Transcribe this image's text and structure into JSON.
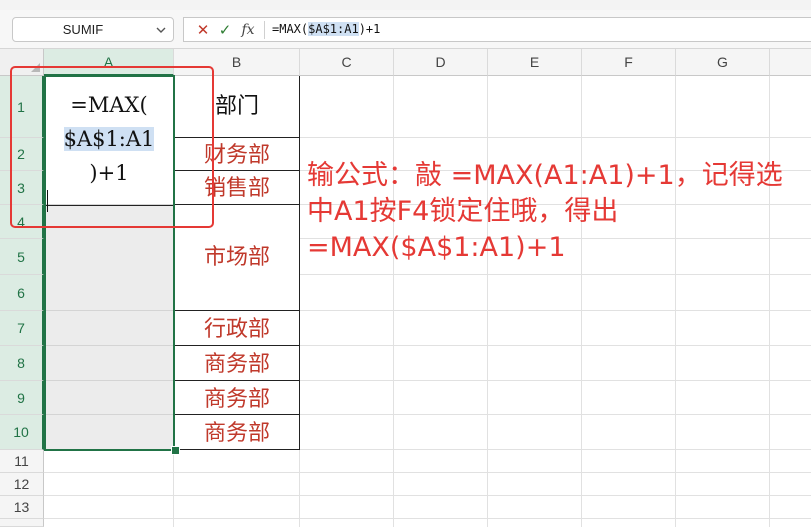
{
  "formula_bar": {
    "name_box": "SUMIF",
    "cancel_icon": "✕",
    "confirm_icon": "✓",
    "function_icon": "fx",
    "formula_prefix": "=MAX(",
    "formula_ref": "$A$1:A1",
    "formula_suffix": ")+1"
  },
  "columns": [
    "A",
    "B",
    "C",
    "D",
    "E",
    "F",
    "G"
  ],
  "rows": [
    "1",
    "2",
    "3",
    "4",
    "5",
    "6",
    "7",
    "8",
    "9",
    "10",
    "11",
    "12",
    "13"
  ],
  "cell_editor": {
    "line1": "=MAX(",
    "line2_ref": "$A$1:A1",
    "line3": ")+1"
  },
  "column_b": {
    "header": "部门",
    "departments": [
      "财务部",
      "销售部",
      "市场部",
      "行政部",
      "商务部",
      "商务部",
      "商务部"
    ]
  },
  "annotation": {
    "text": "输公式：敲 =MAX(A1:A1)+1，记得选中A1按F4锁定住哦，得出=MAX($A$1:A1)+1"
  },
  "colors": {
    "selection": "#217346",
    "annotation": "#e53935",
    "department_text": "#c0392b",
    "reference_highlight": "#cfe0f3"
  }
}
